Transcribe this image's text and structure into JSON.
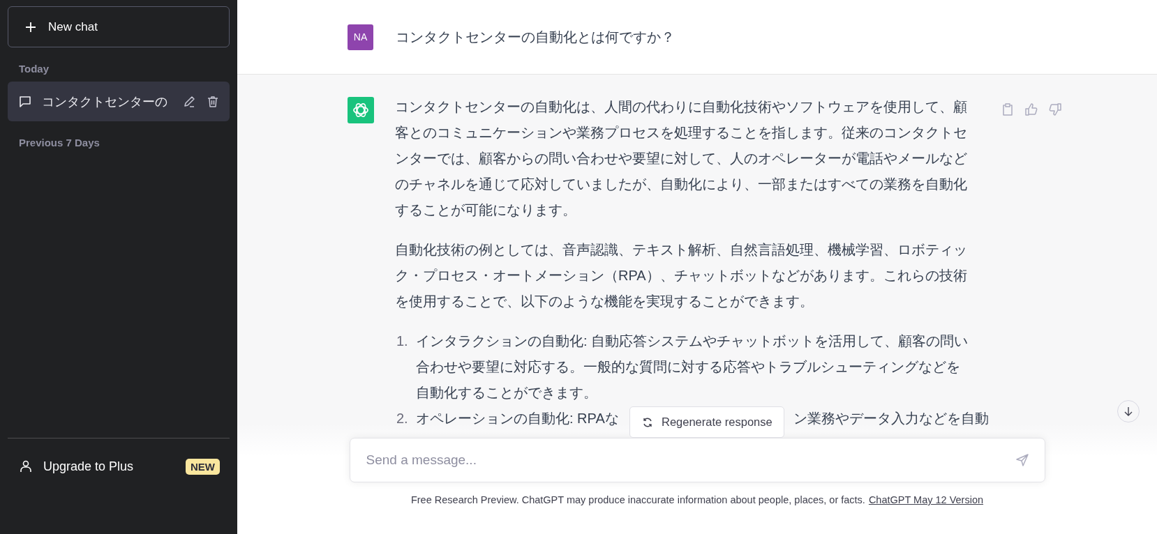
{
  "sidebar": {
    "new_chat_button": "New chat",
    "sections": [
      {
        "heading": "Today",
        "items": [
          {
            "title": "コンタクトセンターの",
            "selected": true
          }
        ]
      },
      {
        "heading": "Previous 7 Days"
      }
    ],
    "upgrade": {
      "label": "Upgrade to Plus",
      "badge": "NEW"
    }
  },
  "conversation": {
    "user": {
      "avatar": "NA",
      "message": "コンタクトセンターの自動化とは何ですか？"
    },
    "assistant": {
      "paragraphs": [
        "コンタクトセンターの自動化は、人間の代わりに自動化技術やソフトウェアを使用して、顧客とのコミュニケーションや業務プロセスを処理することを指します。従来のコンタクトセンターでは、顧客からの問い合わせや要望に対して、人のオペレーターが電話やメールなどのチャネルを通じて応対していましたが、自動化により、一部またはすべての業務を自動化することが可能になります。",
        "自動化技術の例としては、音声認識、テキスト解析、自然言語処理、機械学習、ロボティック・プロセス・オートメーション（RPA）、チャットボットなどがあります。これらの技術を使用することで、以下のような機能を実現することができます。"
      ],
      "list": [
        {
          "number": "1.",
          "parts": [
            "インタラクションの自動化: 自動応答システムやチャットボットを活用して、顧客の問い合わせや要望に対応する。一般的な質問に対する応答やトラブルシューティングなどを自動化することができます。"
          ]
        },
        {
          "number": "2.",
          "parts": [
            "オペレーションの自動化: RPAな",
            "ン業務やデータ入力などを自動"
          ]
        }
      ]
    }
  },
  "regenerate_button": "Regenerate response",
  "composer": {
    "placeholder": "Send a message..."
  },
  "footer": {
    "text": "Free Research Preview. ChatGPT may produce inaccurate information about people, places, or facts.",
    "link": "ChatGPT May 12 Version"
  }
}
